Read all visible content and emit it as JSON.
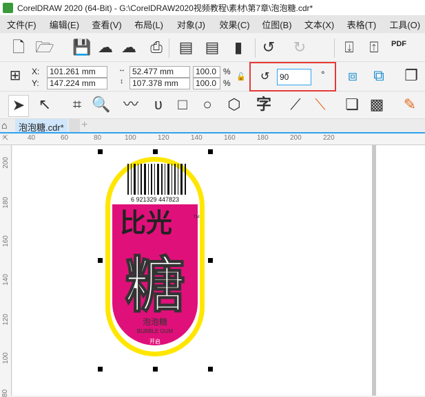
{
  "title": "CorelDRAW 2020 (64-Bit) - G:\\CorelDRAW2020视频教程\\素材\\第7章\\泡泡糖.cdr*",
  "menu": [
    "文件(F)",
    "编辑(E)",
    "查看(V)",
    "布局(L)",
    "对象(J)",
    "效果(C)",
    "位图(B)",
    "文本(X)",
    "表格(T)",
    "工具(O)"
  ],
  "props": {
    "x_label": "X:",
    "y_label": "Y:",
    "x": "101.261 mm",
    "y": "147.224 mm",
    "width": "52.477 mm",
    "height": "107.378 mm",
    "scale_x": "100.0",
    "scale_y": "100.0",
    "percent": "%",
    "rotation": "90",
    "degree": "°"
  },
  "toolbar": {
    "pdf": "PDF"
  },
  "tab": {
    "label": "泡泡糖.cdr*",
    "add": "+"
  },
  "hruler": [
    "40",
    "60",
    "80",
    "100",
    "120",
    "140",
    "160",
    "180",
    "200",
    "220"
  ],
  "vruler": [
    "200",
    "180",
    "160",
    "140",
    "120",
    "100",
    "80"
  ],
  "label": {
    "barcode": "6 921329 447823",
    "brand": "比光",
    "tm": "TM",
    "big": "糖",
    "sub": "泡泡糖",
    "en": "BUBBLE GUM",
    "open": "开启"
  },
  "colors": {
    "magenta": "#e0107a",
    "yellow": "#ffe600",
    "highlight": "#e53935"
  }
}
